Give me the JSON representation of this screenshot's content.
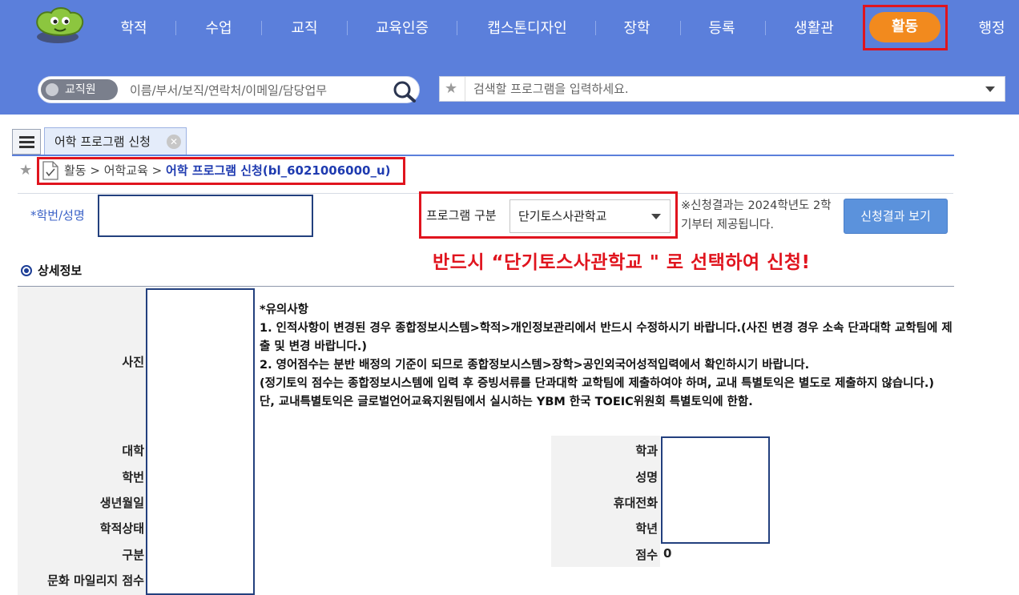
{
  "nav": {
    "items": [
      "학적",
      "수업",
      "교직",
      "교육인증",
      "캡스톤디자인",
      "장학",
      "등록",
      "생활관"
    ],
    "active": "활동",
    "last": "행정"
  },
  "search": {
    "scope_label": "교직원",
    "employee_placeholder": "이름/부서/보직/연락처/이메일/담당업무",
    "program_placeholder": "검색할 프로그램을 입력하세요."
  },
  "tab": {
    "label": "어학 프로그램 신청"
  },
  "breadcrumb": {
    "path": "활동 > 어학교육 > ",
    "current": "어학 프로그램 신청(bl_6021006000_u)"
  },
  "form": {
    "student_label": "*학번/성명",
    "student_value": "",
    "program_label": "프로그램 구분",
    "program_selected": "단기토스사관학교",
    "note": "※신청결과는 2024학년도 2학기부터 제공됩니다.",
    "result_button": "신청결과 보기"
  },
  "annotation": "반드시 “단기토스사관학교 \" 로 선택하여 신청!",
  "detail": {
    "title": "상세정보",
    "photo_label": "사진",
    "notice": [
      "*유의사항",
      "1. 인적사항이 변경된 경우 종합정보시스템>학적>개인정보관리에서 반드시 수정하시기 바랍니다.(사진 변경 경우 소속 단과대학 교학팀에 제출 및 변경 바랍니다.)",
      "2. 영어점수는 분반 배정의 기준이 되므로 종합정보시스템>장학>공인외국어성적입력에서 확인하시기 바랍니다.",
      "(정기토익 점수는 종합정보시스템에 입력 후 증빙서류를 단과대학 교학팀에 제출하여야 하며, 교내 특별토익은 별도로 제출하지 않습니다.)",
      "단, 교내특별토익은 글로벌언어교육지원팀에서 실시하는 YBM 한국 TOEIC위원회 특별토익에 한함."
    ],
    "left_labels": [
      "대학",
      "학번",
      "생년월일",
      "학적상태",
      "구분",
      "문화 마일리지 점수"
    ],
    "right_labels": [
      "학과",
      "성명",
      "휴대전화",
      "학년",
      "점수"
    ],
    "score_value": "0"
  },
  "colors": {
    "nav_bg": "#5b7fdb",
    "active_bg": "#f28a1e",
    "highlight": "#e0141e",
    "button": "#5b92dc"
  }
}
